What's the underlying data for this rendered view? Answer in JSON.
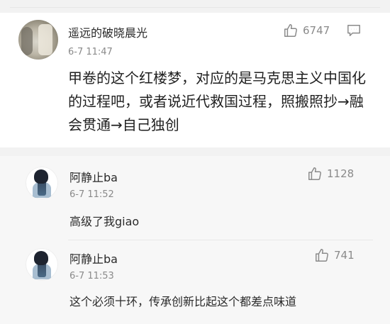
{
  "main_comment": {
    "username": "遥远的破晓晨光",
    "time": "6-7 11:47",
    "likes": "6747",
    "text": "甲卷的这个红楼梦，对应的是马克思主义中国化的过程吧，或者说近代救国过程，照搬照抄→融会贯通→自己独创",
    "icons": [
      "thumb-up-icon",
      "comment-icon"
    ]
  },
  "replies": [
    {
      "username": "阿静止ba",
      "time": "6-7 11:52",
      "likes": "1128",
      "text": "高级了我giao"
    },
    {
      "username": "阿静止ba",
      "time": "6-7 11:53",
      "likes": "741",
      "text": "这个必须十环，传承创新比起这个都差点味道"
    }
  ]
}
